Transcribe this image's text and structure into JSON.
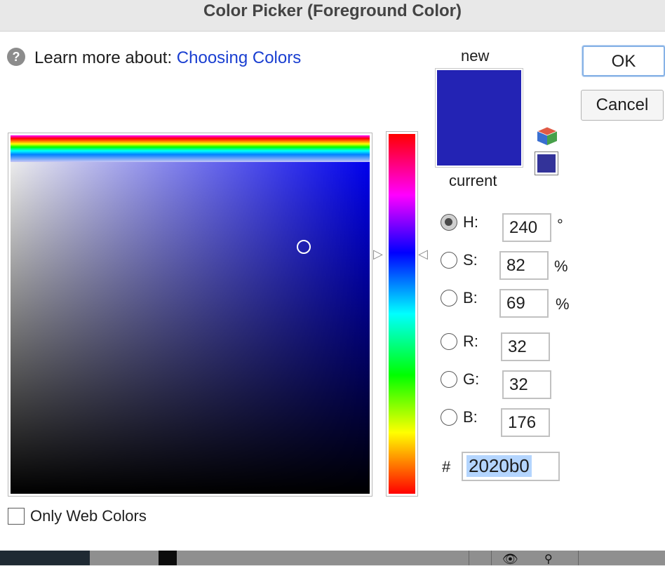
{
  "window": {
    "title": "Color Picker (Foreground Color)"
  },
  "help": {
    "prefix": "Learn more about:",
    "link": "Choosing Colors",
    "icon": "question-icon"
  },
  "buttons": {
    "ok": "OK",
    "cancel": "Cancel"
  },
  "swatch": {
    "new_label": "new",
    "current_label": "current",
    "new_color": "#2323b4",
    "current_color": "#2323b4",
    "web_color": "#333399"
  },
  "fields": {
    "hsb": [
      {
        "key": "h",
        "label": "H:",
        "value": "240",
        "unit": "°",
        "selected": true
      },
      {
        "key": "s",
        "label": "S:",
        "value": "82",
        "unit": "%",
        "selected": false
      },
      {
        "key": "b",
        "label": "B:",
        "value": "69",
        "unit": "%",
        "selected": false
      }
    ],
    "rgb": [
      {
        "key": "r",
        "label": "R:",
        "value": "32"
      },
      {
        "key": "g",
        "label": "G:",
        "value": "32"
      },
      {
        "key": "b",
        "label": "B:",
        "value": "176"
      }
    ],
    "hex_label": "#",
    "hex_value": "2020b0"
  },
  "options": {
    "only_web_colors": "Only Web Colors",
    "only_web_colors_checked": false
  },
  "colors": {
    "link": "#1a3fd1",
    "selection": "#b4d5fe",
    "ok_ring": "#86b2e6"
  }
}
